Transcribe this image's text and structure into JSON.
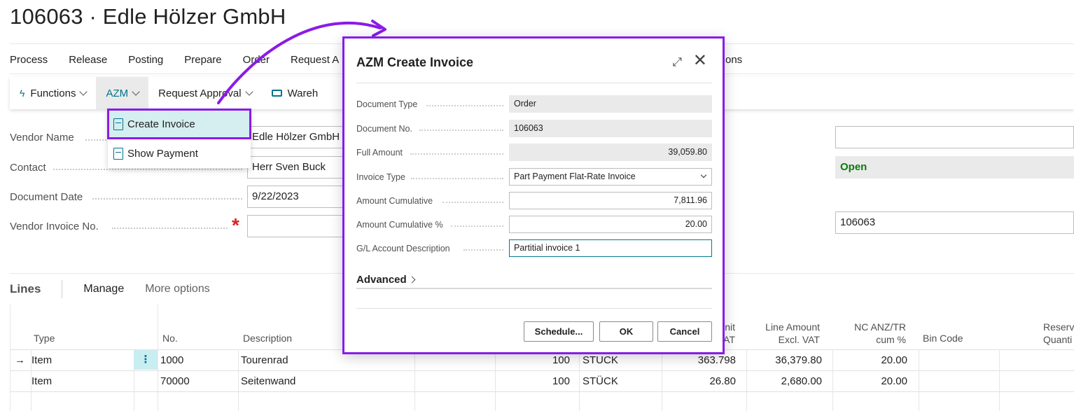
{
  "page": {
    "title": "106063 · Edle Hölzer GmbH"
  },
  "action_bar": [
    "Process",
    "Release",
    "Posting",
    "Prepare",
    "Order",
    "Request A",
    "ons"
  ],
  "command_bar": {
    "functions": "Functions",
    "azm": "AZM",
    "request_approval": "Request Approval",
    "warehouse": "Wareh"
  },
  "azm_menu": {
    "create_invoice": "Create Invoice",
    "show_payment": "Show Payment"
  },
  "form": {
    "vendor_name_label": "Vendor Name",
    "vendor_name": "Edle Hölzer GmbH",
    "contact_label": "Contact",
    "contact": "Herr Sven Buck",
    "document_date_label": "Document Date",
    "document_date": "9/22/2023",
    "vendor_invoice_no_label": "Vendor Invoice No.",
    "vendor_invoice_no": "",
    "status": "Open",
    "right_field_value": "106063",
    "required_mark": "*"
  },
  "lines": {
    "title": "Lines",
    "manage": "Manage",
    "more_options": "More options",
    "headers": {
      "type": "Type",
      "no": "No.",
      "description": "Description",
      "unit_price_part1": "nit",
      "unit_price_part2": "AT",
      "line_amount_1": "Line Amount",
      "line_amount_2": "Excl. VAT",
      "nc_1": "NC ANZ/TR",
      "nc_2": "cum %",
      "bin_code": "Bin Code",
      "reserved_1": "Reserve",
      "reserved_2": "Quanti"
    },
    "rows": [
      {
        "arrow": "→",
        "type": "Item",
        "no": "1000",
        "description": "Tourenrad",
        "quantity": "100",
        "unit": "STUCK",
        "unit_price": "363.798",
        "line_amount": "36,379.80",
        "nc": "20.00"
      },
      {
        "arrow": "",
        "type": "Item",
        "no": "70000",
        "description": "Seitenwand",
        "quantity": "100",
        "unit": "STÜCK",
        "unit_price": "26.80",
        "line_amount": "2,680.00",
        "nc": "20.00"
      }
    ],
    "row_menu_glyph": "⋮"
  },
  "dialog": {
    "title": "AZM Create Invoice",
    "expand_glyph": "⤢",
    "close_glyph": "✕",
    "fields": [
      {
        "label": "Document Type",
        "value": "Order"
      },
      {
        "label": "Document No.",
        "value": "106063"
      },
      {
        "label": "Full Amount",
        "value": "39,059.80"
      },
      {
        "label": "Invoice Type",
        "value": "Part Payment Flat-Rate Invoice"
      },
      {
        "label": "Amount Cumulative",
        "value": "7,811.96"
      },
      {
        "label": "Amount Cumulative %",
        "value": "20.00"
      },
      {
        "label": "G/L Account Description",
        "value": "Partitial invoice 1"
      }
    ],
    "advanced": "Advanced",
    "buttons": {
      "schedule": "Schedule...",
      "ok": "OK",
      "cancel": "Cancel"
    }
  },
  "colors": {
    "highlight": "#8a1be8",
    "accent": "#00748b",
    "status_open": "#0b7a0b"
  }
}
